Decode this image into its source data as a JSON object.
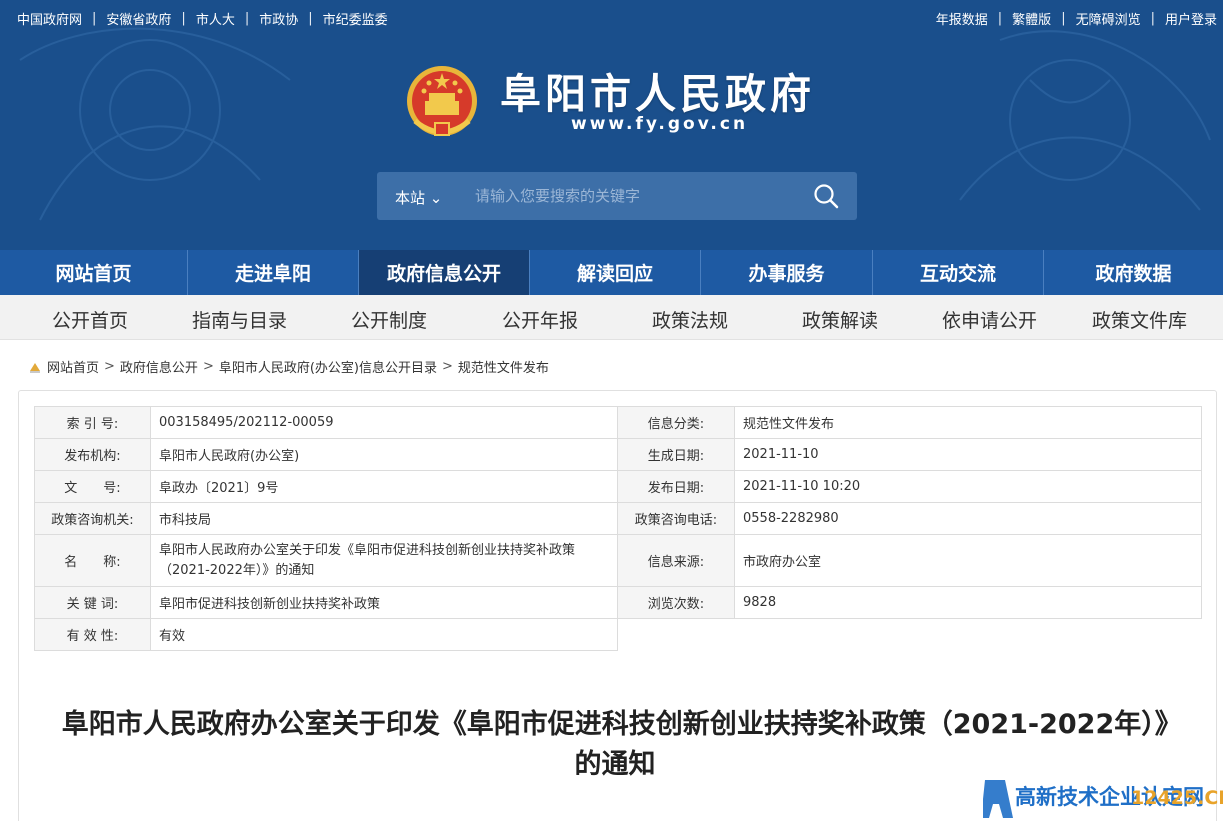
{
  "topbar": {
    "left_links": [
      "中国政府网",
      "安徽省政府",
      "市人大",
      "市政协",
      "市纪委监委"
    ],
    "right_links": [
      "年报数据",
      "繁體版",
      "无障碍浏览",
      "用户登录"
    ],
    "separator": "|"
  },
  "brand": {
    "title": "阜阳市人民政府",
    "domain": "www.fy.gov.cn"
  },
  "search": {
    "scope": "本站",
    "placeholder": "请输入您要搜索的关键字"
  },
  "main_nav": {
    "items": [
      "网站首页",
      "走进阜阳",
      "政府信息公开",
      "解读回应",
      "办事服务",
      "互动交流",
      "政府数据"
    ],
    "active_index": 2
  },
  "sub_nav": {
    "items": [
      "公开首页",
      "指南与目录",
      "公开制度",
      "公开年报",
      "政策法规",
      "政策解读",
      "依申请公开",
      "政策文件库"
    ]
  },
  "breadcrumb": {
    "items": [
      "网站首页",
      "政府信息公开",
      "阜阳市人民政府(办公室)信息公开目录",
      "规范性文件发布"
    ],
    "separator": ">"
  },
  "meta": {
    "index_label": "索 引 号:",
    "index_value": "003158495/202112-00059",
    "category_label": "信息分类:",
    "category_value": "规范性文件发布",
    "publisher_label": "发布机构:",
    "publisher_value": "阜阳市人民政府(办公室)",
    "created_label": "生成日期:",
    "created_value": "2021-11-10",
    "docno_label": "文　　号:",
    "docno_value": "阜政办〔2021〕9号",
    "published_label": "发布日期:",
    "published_value": "2021-11-10 10:20",
    "consult_org_label": "政策咨询机关:",
    "consult_org_value": "市科技局",
    "consult_phone_label": "政策咨询电话:",
    "consult_phone_value": "0558-2282980",
    "name_label": "名　　称:",
    "name_value": "阜阳市人民政府办公室关于印发《阜阳市促进科技创新创业扶持奖补政策（2021-2022年）》的通知",
    "source_label": "信息来源:",
    "source_value": "市政府办公室",
    "keywords_label": "关 键 词:",
    "keywords_value": "阜阳市促进科技创新创业扶持奖补政策",
    "views_label": "浏览次数:",
    "views_value": "9828",
    "validity_label": "有 效 性:",
    "validity_value": "有效"
  },
  "document": {
    "title": "阜阳市人民政府办公室关于印发《阜阳市促进科技创新创业扶持奖补政策（2021-2022年）》的通知"
  },
  "watermark": {
    "text": "高新技术企业认定网",
    "domain": "12425.CN"
  }
}
